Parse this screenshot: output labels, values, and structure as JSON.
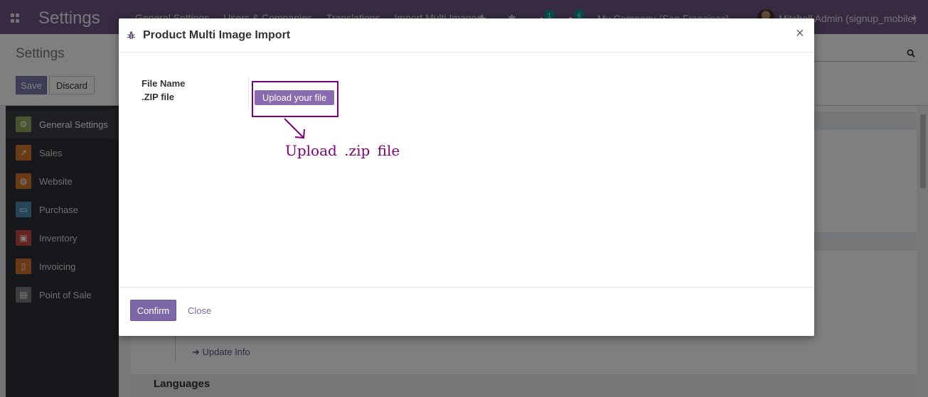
{
  "navbar": {
    "app_title": "Settings",
    "menu": [
      "General Settings",
      "Users & Companies",
      "Translations",
      "Import Multi Images"
    ],
    "activity_badge": "1",
    "message_badge": "6",
    "company": "My Company (San Francisco)",
    "user": "Mitchell Admin (signup_mobile)"
  },
  "control_panel": {
    "title": "Settings",
    "save_label": "Save",
    "discard_label": "Discard"
  },
  "sidebar": {
    "items": [
      {
        "label": "General Settings",
        "color": "#8fa85a"
      },
      {
        "label": "Sales",
        "color": "#d2792f"
      },
      {
        "label": "Website",
        "color": "#d4742f"
      },
      {
        "label": "Purchase",
        "color": "#4f8fb0"
      },
      {
        "label": "Inventory",
        "color": "#c44b43"
      },
      {
        "label": "Invoicing",
        "color": "#d4742f"
      },
      {
        "label": "Point of Sale",
        "color": "#7a7a7a"
      }
    ]
  },
  "content": {
    "update_info": "Update Info",
    "languages": "Languages"
  },
  "modal": {
    "title": "Product Multi Image Import",
    "close_glyph": "×",
    "field_label_1": "File Name",
    "field_label_2": ".ZIP file",
    "upload_label": "Upload your file",
    "annotation": "Upload .zip file",
    "confirm_label": "Confirm",
    "close_label": "Close"
  },
  "colors": {
    "brand": "#6d5780",
    "accent": "#7c68a7",
    "annotation": "#800080"
  }
}
